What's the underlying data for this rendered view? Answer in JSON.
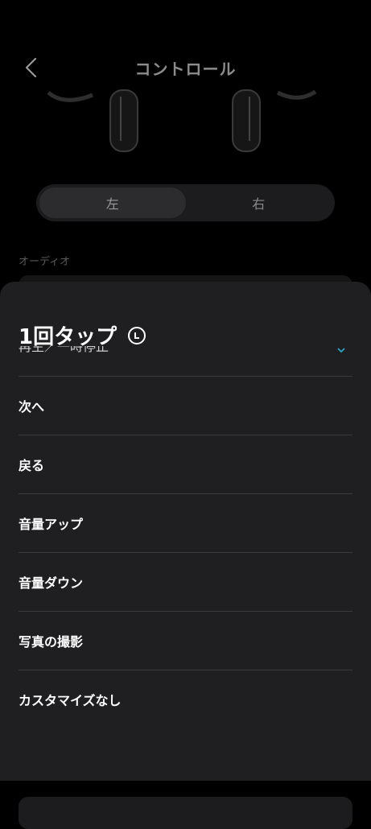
{
  "header": {
    "title": "コントロール"
  },
  "segment": {
    "left": "左",
    "right": "右"
  },
  "section": {
    "audio_label": "オーディオ"
  },
  "sheet": {
    "title": "1回タップ",
    "partial_item": "再生／一時停止",
    "options": [
      "次へ",
      "戻る",
      "音量アップ",
      "音量ダウン",
      "写真の撮影",
      "カスタマイズなし"
    ]
  },
  "colors": {
    "sheet_bg": "#1f1f21",
    "accent": "#2aa8c8"
  }
}
